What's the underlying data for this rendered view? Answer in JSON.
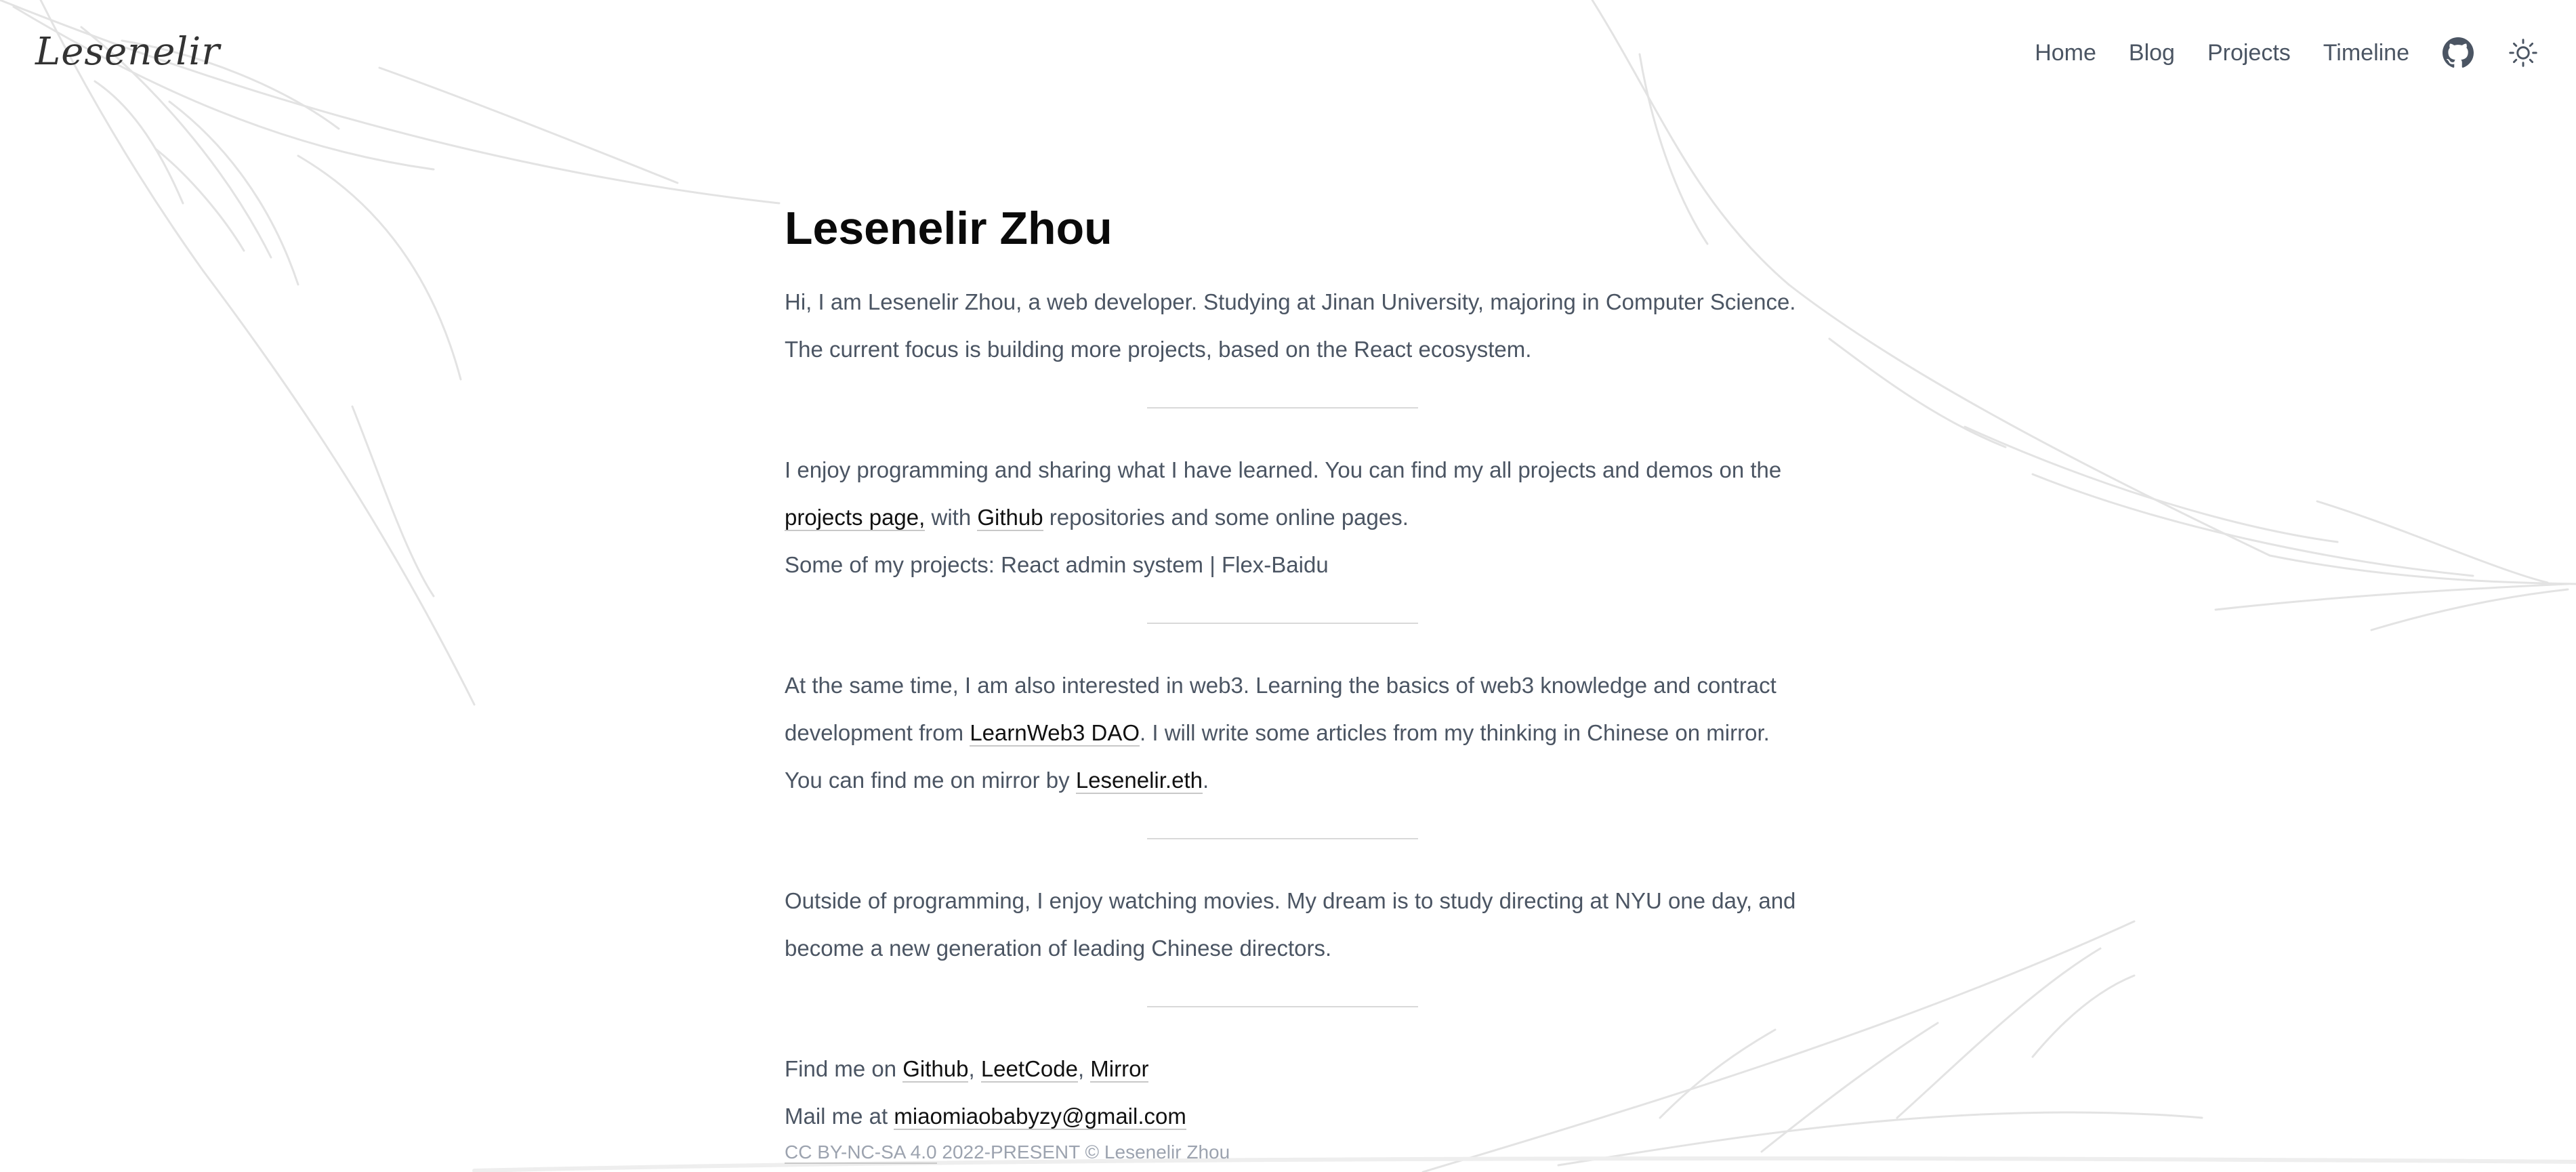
{
  "header": {
    "logo": "Lesenelir",
    "nav": {
      "home": "Home",
      "blog": "Blog",
      "projects": "Projects",
      "timeline": "Timeline"
    },
    "icons": [
      "github-icon",
      "sun-icon"
    ]
  },
  "main": {
    "title": "Lesenelir Zhou",
    "intro": {
      "text": "Hi, I am Lesenelir Zhou, a web developer. Studying at Jinan University, majoring in Computer Science. The current focus is building more projects, based on the React ecosystem."
    },
    "projects_section": {
      "text1": "I enjoy programming and sharing what I have learned. You can find my all projects and demos on the ",
      "projects_link": "projects page,",
      "text2": " with ",
      "github_link": "Github",
      "text3": " repositories and some online pages.",
      "line2": "Some of my projects: React admin system | Flex-Baidu"
    },
    "web3_section": {
      "text1": "At the same time, I am also interested in web3. Learning the basics of web3 knowledge and contract development from ",
      "dao_link": "LearnWeb3 DAO",
      "text2": ". I will write some articles from my thinking in Chinese on mirror.",
      "line2_text": "You can find me on mirror by ",
      "eth_link": "Lesenelir.eth",
      "line2_end": "."
    },
    "hobby_section": {
      "text": "Outside of programming, I enjoy watching movies. My dream is to study directing at NYU one day, and become a new generation of leading Chinese directors."
    },
    "contact": {
      "find_prefix": "Find me on ",
      "github": "Github",
      "sep1": ", ",
      "leetcode": "LeetCode",
      "sep2": ", ",
      "mirror": "Mirror",
      "mail_prefix": "Mail me at ",
      "email": "miaomiaobabyzy@gmail.com"
    }
  },
  "footer": {
    "license": "CC BY-NC-SA 4.0",
    "copyright": " 2022-PRESENT © Lesenelir Zhou"
  },
  "colors": {
    "background": "#ffffff",
    "text": "#4b5563",
    "heading": "#0a0a0a",
    "muted": "#9ca3af"
  }
}
